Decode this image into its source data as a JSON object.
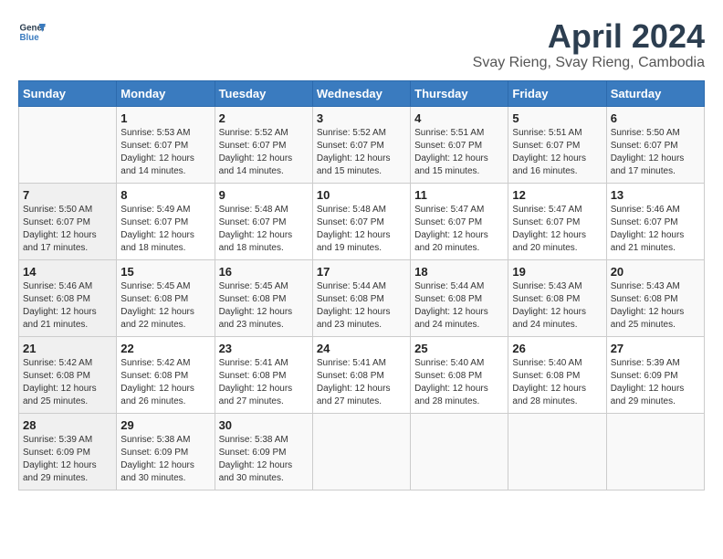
{
  "header": {
    "logo_line1": "General",
    "logo_line2": "Blue",
    "month_year": "April 2024",
    "location": "Svay Rieng, Svay Rieng, Cambodia"
  },
  "weekdays": [
    "Sunday",
    "Monday",
    "Tuesday",
    "Wednesday",
    "Thursday",
    "Friday",
    "Saturday"
  ],
  "weeks": [
    [
      {
        "day": "",
        "info": ""
      },
      {
        "day": "1",
        "info": "Sunrise: 5:53 AM\nSunset: 6:07 PM\nDaylight: 12 hours\nand 14 minutes."
      },
      {
        "day": "2",
        "info": "Sunrise: 5:52 AM\nSunset: 6:07 PM\nDaylight: 12 hours\nand 14 minutes."
      },
      {
        "day": "3",
        "info": "Sunrise: 5:52 AM\nSunset: 6:07 PM\nDaylight: 12 hours\nand 15 minutes."
      },
      {
        "day": "4",
        "info": "Sunrise: 5:51 AM\nSunset: 6:07 PM\nDaylight: 12 hours\nand 15 minutes."
      },
      {
        "day": "5",
        "info": "Sunrise: 5:51 AM\nSunset: 6:07 PM\nDaylight: 12 hours\nand 16 minutes."
      },
      {
        "day": "6",
        "info": "Sunrise: 5:50 AM\nSunset: 6:07 PM\nDaylight: 12 hours\nand 17 minutes."
      }
    ],
    [
      {
        "day": "7",
        "info": "Sunrise: 5:50 AM\nSunset: 6:07 PM\nDaylight: 12 hours\nand 17 minutes."
      },
      {
        "day": "8",
        "info": "Sunrise: 5:49 AM\nSunset: 6:07 PM\nDaylight: 12 hours\nand 18 minutes."
      },
      {
        "day": "9",
        "info": "Sunrise: 5:48 AM\nSunset: 6:07 PM\nDaylight: 12 hours\nand 18 minutes."
      },
      {
        "day": "10",
        "info": "Sunrise: 5:48 AM\nSunset: 6:07 PM\nDaylight: 12 hours\nand 19 minutes."
      },
      {
        "day": "11",
        "info": "Sunrise: 5:47 AM\nSunset: 6:07 PM\nDaylight: 12 hours\nand 20 minutes."
      },
      {
        "day": "12",
        "info": "Sunrise: 5:47 AM\nSunset: 6:07 PM\nDaylight: 12 hours\nand 20 minutes."
      },
      {
        "day": "13",
        "info": "Sunrise: 5:46 AM\nSunset: 6:07 PM\nDaylight: 12 hours\nand 21 minutes."
      }
    ],
    [
      {
        "day": "14",
        "info": "Sunrise: 5:46 AM\nSunset: 6:08 PM\nDaylight: 12 hours\nand 21 minutes."
      },
      {
        "day": "15",
        "info": "Sunrise: 5:45 AM\nSunset: 6:08 PM\nDaylight: 12 hours\nand 22 minutes."
      },
      {
        "day": "16",
        "info": "Sunrise: 5:45 AM\nSunset: 6:08 PM\nDaylight: 12 hours\nand 23 minutes."
      },
      {
        "day": "17",
        "info": "Sunrise: 5:44 AM\nSunset: 6:08 PM\nDaylight: 12 hours\nand 23 minutes."
      },
      {
        "day": "18",
        "info": "Sunrise: 5:44 AM\nSunset: 6:08 PM\nDaylight: 12 hours\nand 24 minutes."
      },
      {
        "day": "19",
        "info": "Sunrise: 5:43 AM\nSunset: 6:08 PM\nDaylight: 12 hours\nand 24 minutes."
      },
      {
        "day": "20",
        "info": "Sunrise: 5:43 AM\nSunset: 6:08 PM\nDaylight: 12 hours\nand 25 minutes."
      }
    ],
    [
      {
        "day": "21",
        "info": "Sunrise: 5:42 AM\nSunset: 6:08 PM\nDaylight: 12 hours\nand 25 minutes."
      },
      {
        "day": "22",
        "info": "Sunrise: 5:42 AM\nSunset: 6:08 PM\nDaylight: 12 hours\nand 26 minutes."
      },
      {
        "day": "23",
        "info": "Sunrise: 5:41 AM\nSunset: 6:08 PM\nDaylight: 12 hours\nand 27 minutes."
      },
      {
        "day": "24",
        "info": "Sunrise: 5:41 AM\nSunset: 6:08 PM\nDaylight: 12 hours\nand 27 minutes."
      },
      {
        "day": "25",
        "info": "Sunrise: 5:40 AM\nSunset: 6:08 PM\nDaylight: 12 hours\nand 28 minutes."
      },
      {
        "day": "26",
        "info": "Sunrise: 5:40 AM\nSunset: 6:08 PM\nDaylight: 12 hours\nand 28 minutes."
      },
      {
        "day": "27",
        "info": "Sunrise: 5:39 AM\nSunset: 6:09 PM\nDaylight: 12 hours\nand 29 minutes."
      }
    ],
    [
      {
        "day": "28",
        "info": "Sunrise: 5:39 AM\nSunset: 6:09 PM\nDaylight: 12 hours\nand 29 minutes."
      },
      {
        "day": "29",
        "info": "Sunrise: 5:38 AM\nSunset: 6:09 PM\nDaylight: 12 hours\nand 30 minutes."
      },
      {
        "day": "30",
        "info": "Sunrise: 5:38 AM\nSunset: 6:09 PM\nDaylight: 12 hours\nand 30 minutes."
      },
      {
        "day": "",
        "info": ""
      },
      {
        "day": "",
        "info": ""
      },
      {
        "day": "",
        "info": ""
      },
      {
        "day": "",
        "info": ""
      }
    ]
  ]
}
